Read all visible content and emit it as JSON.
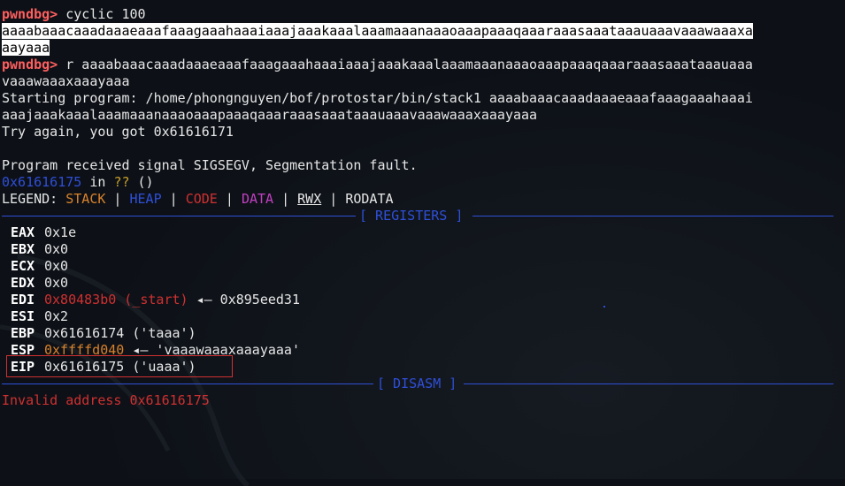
{
  "prompt": "pwndbg>",
  "top_partial": "pwndbg> cyclic 100",
  "lines": {
    "cmd1": " cyclic 100",
    "cyclic_out1": "aaaabaaacaaadaaaeaaafaaagaaahaaaiaaajaaakaaalaaamaaanaaaoaaapaaaqaaaraaasaaataaauaaavaaawaaaxa",
    "cyclic_out2": "aayaaa",
    "cmd2": " r aaaabaaacaaadaaaeaaafaaagaaahaaaiaaajaaakaaalaaamaaanaaaoaaapaaaqaaaraaasaaataaauaaa",
    "cmd2_cont": "vaaawaaaxaaayaaa",
    "start1": "Starting program: /home/phongnguyen/bof/protostar/bin/stack1 aaaabaaacaaadaaaeaaafaaagaaahaaai",
    "start2": "aaajaaakaaalaaamaaanaaaoaaapaaaqaaaraaasaaataaauaaavaaawaaaxaaayaaa",
    "tryagain": "Try again, you got 0x61616171",
    "blank": "",
    "signal": "Program received signal SIGSEGV, Segmentation fault.",
    "fault_addr": "0x61616175",
    "fault_in": " in ",
    "fault_qq": "??",
    "fault_paren": " ()"
  },
  "legend": {
    "label": "LEGEND: ",
    "stack": "STACK",
    "heap": "HEAP",
    "code": "CODE",
    "data": "DATA",
    "rwx": "RWX",
    "rodata": "RODATA",
    "pipe": " | "
  },
  "sections": {
    "registers": "[ REGISTERS ]",
    "disasm": "[ DISASM ]"
  },
  "registers": [
    {
      "name": "EAX",
      "value": "0x1e",
      "extra": ""
    },
    {
      "name": "EBX",
      "value": "0x0",
      "extra": ""
    },
    {
      "name": "ECX",
      "value": "0x0",
      "extra": ""
    },
    {
      "name": "EDX",
      "value": "0x0",
      "extra": ""
    },
    {
      "name": "EDI",
      "value": "0x80483b0 (_start)",
      "extra": " ◂— 0x895eed31"
    },
    {
      "name": "ESI",
      "value": "0x2",
      "extra": ""
    },
    {
      "name": "EBP",
      "value": "0x61616174 ('taaa')",
      "extra": ""
    },
    {
      "name": "ESP",
      "value": "0xffffd040",
      "extra": " ◂— 'vaaawaaaxaaayaaa'"
    },
    {
      "name": "EIP",
      "value": "0x61616175 ('uaaa')",
      "extra": ""
    }
  ],
  "disasm_msg": "Invalid address 0x61616175",
  "colors": {
    "prompt": "#ff5f5f",
    "blue": "#2f4fd8",
    "stack": "#d9822b",
    "code": "#d03030",
    "data": "#c33fc3",
    "background": "#0d1117"
  }
}
